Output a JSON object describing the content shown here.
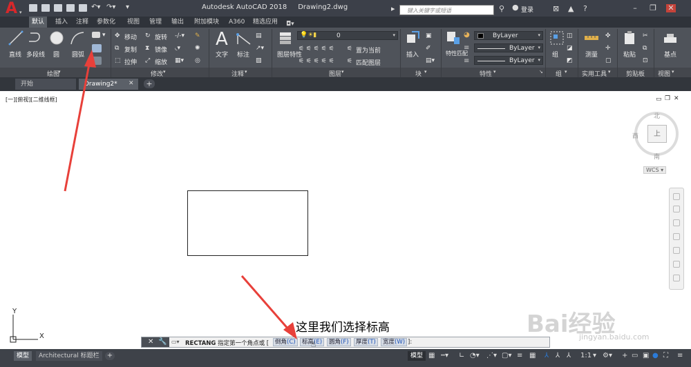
{
  "titlebar": {
    "app_title": "Autodesk AutoCAD 2018",
    "file_name": "Drawing2.dwg",
    "search_placeholder": "键入关键字或短语",
    "login_label": "登录"
  },
  "ribbon_tabs": [
    "默认",
    "插入",
    "注释",
    "参数化",
    "视图",
    "管理",
    "输出",
    "附加模块",
    "A360",
    "精选应用"
  ],
  "panels": {
    "draw": {
      "label": "绘图",
      "tools": [
        "直线",
        "多段线",
        "圆",
        "圆弧"
      ]
    },
    "modify": {
      "label": "修改",
      "tools": [
        "移动",
        "旋转",
        "复制",
        "镜像",
        "拉伸",
        "缩放"
      ]
    },
    "annotation": {
      "label": "注释",
      "tools": [
        "文字",
        "标注"
      ]
    },
    "layers": {
      "label": "图层",
      "tools": [
        "图层特性",
        "置为当前",
        "匹配图层"
      ],
      "current_layer": "0"
    },
    "block": {
      "label": "块",
      "tools": [
        "插入"
      ]
    },
    "properties": {
      "label": "特性",
      "tools": [
        "特性匹配"
      ],
      "values": [
        "ByLayer",
        "ByLayer",
        "ByLayer"
      ]
    },
    "groups": {
      "label": "组",
      "tools": [
        "组"
      ]
    },
    "utilities": {
      "label": "实用工具",
      "tools": [
        "测量"
      ]
    },
    "clipboard": {
      "label": "剪贴板",
      "tools": [
        "粘贴"
      ]
    },
    "view": {
      "label": "视图",
      "tools": [
        "基点"
      ]
    }
  },
  "doc_tabs": [
    "开始",
    "Drawing2*"
  ],
  "viewport_label": "[一][俯视][二维线框]",
  "viewcube": {
    "north": "北",
    "south": "南",
    "west": "西",
    "face": "上",
    "wcs": "WCS"
  },
  "ucs": {
    "x": "X",
    "y": "Y"
  },
  "annotation_text": "这里我们选择标高",
  "command": {
    "name": "RECTANG",
    "prompt": "指定第一个角点或 [",
    "options": [
      {
        "label": "倒角",
        "key": "(C)"
      },
      {
        "label": "标高",
        "key": "(E)"
      },
      {
        "label": "圆角",
        "key": "(F)"
      },
      {
        "label": "厚度",
        "key": "(T)"
      },
      {
        "label": "宽度",
        "key": "(W)"
      }
    ],
    "suffix": "]:"
  },
  "layout_tabs": [
    "模型",
    "Architectural 标题栏"
  ],
  "status": {
    "model_label": "模型",
    "scale": "1:1"
  },
  "watermark": {
    "brand": "Bai经验",
    "url": "jingyan.baidu.com"
  },
  "colors": {
    "arrow": "#e8403a",
    "ribbon": "#4f535a",
    "titlebar": "#3c4049",
    "accent": "#2b7bd8"
  }
}
